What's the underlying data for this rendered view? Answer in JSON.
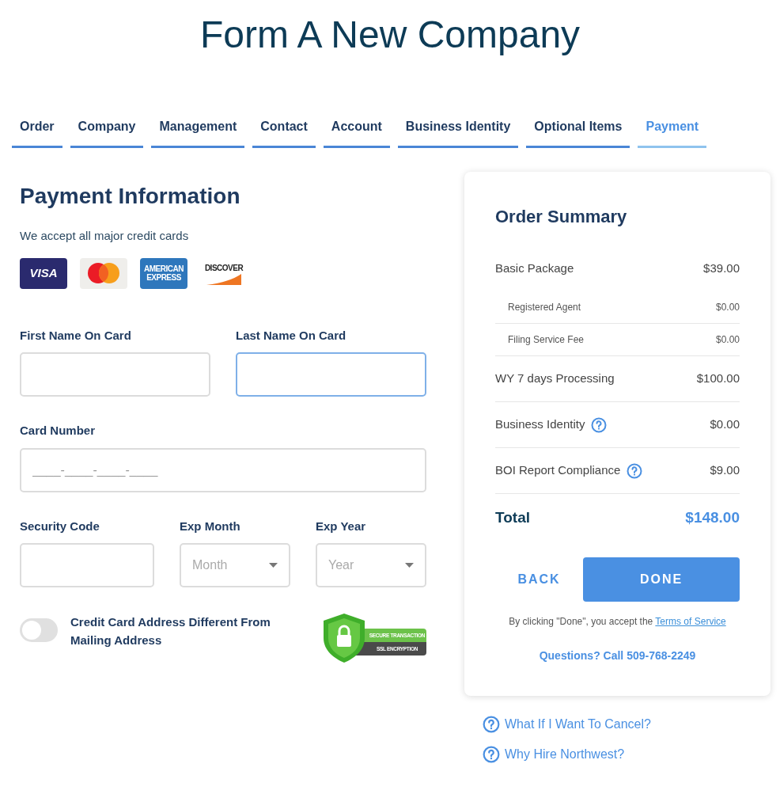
{
  "title": "Form A New Company",
  "tabs": [
    {
      "label": "Order",
      "selected": false
    },
    {
      "label": "Company",
      "selected": false
    },
    {
      "label": "Management",
      "selected": false
    },
    {
      "label": "Contact",
      "selected": false
    },
    {
      "label": "Account",
      "selected": false
    },
    {
      "label": "Business Identity",
      "selected": false
    },
    {
      "label": "Optional Items",
      "selected": false
    },
    {
      "label": "Payment",
      "selected": true
    }
  ],
  "payment": {
    "heading": "Payment Information",
    "accept_text": "We accept all major credit cards",
    "cards": [
      {
        "kind": "visa",
        "text": "VISA"
      },
      {
        "kind": "mastercard"
      },
      {
        "kind": "amex",
        "text": "AMERICAN EXPRESS"
      },
      {
        "kind": "discover",
        "text": "DISCOVER"
      }
    ],
    "first_name": {
      "label": "First Name On Card",
      "focused": false
    },
    "last_name": {
      "label": "Last Name On Card",
      "focused": true
    },
    "card_number": {
      "label": "Card Number",
      "placeholder": "____-____-____-____",
      "focused": false
    },
    "security_code": {
      "label": "Security Code",
      "focused": false
    },
    "exp_month": {
      "label": "Exp Month",
      "placeholder": "Month"
    },
    "exp_year": {
      "label": "Exp Year",
      "placeholder": "Year"
    },
    "address_toggle": {
      "label": "Credit Card Address Different From Mailing Address",
      "on": false
    },
    "ssl_badge": {
      "line_1": "SECURE TRANSACTION",
      "line_2": "SSL ENCRYPTION"
    }
  },
  "summary": {
    "heading": "Order Summary",
    "items": [
      {
        "kind": "main",
        "label": "Basic Package",
        "price": "$39.00",
        "help": false
      },
      {
        "kind": "sub",
        "label": "Registered Agent",
        "price": "$0.00",
        "help": false
      },
      {
        "kind": "sub",
        "label": "Filing Service Fee",
        "price": "$0.00",
        "help": false
      },
      {
        "kind": "main",
        "label": "WY 7 days Processing",
        "price": "$100.00",
        "help": false
      },
      {
        "kind": "main",
        "label": "Business Identity",
        "price": "$0.00",
        "help": true
      },
      {
        "kind": "main",
        "label": "BOI Report Compliance",
        "price": "$9.00",
        "help": true
      }
    ],
    "total_label": "Total",
    "total": "$148.00",
    "back": "BACK",
    "done": "DONE",
    "terms_text": "By clicking \"Done\", you accept the",
    "terms_link": "Terms of Service",
    "questions": "Questions? Call 509-768-2249"
  },
  "faq_links": [
    "What If I Want To Cancel?",
    "Why Hire Northwest?"
  ]
}
